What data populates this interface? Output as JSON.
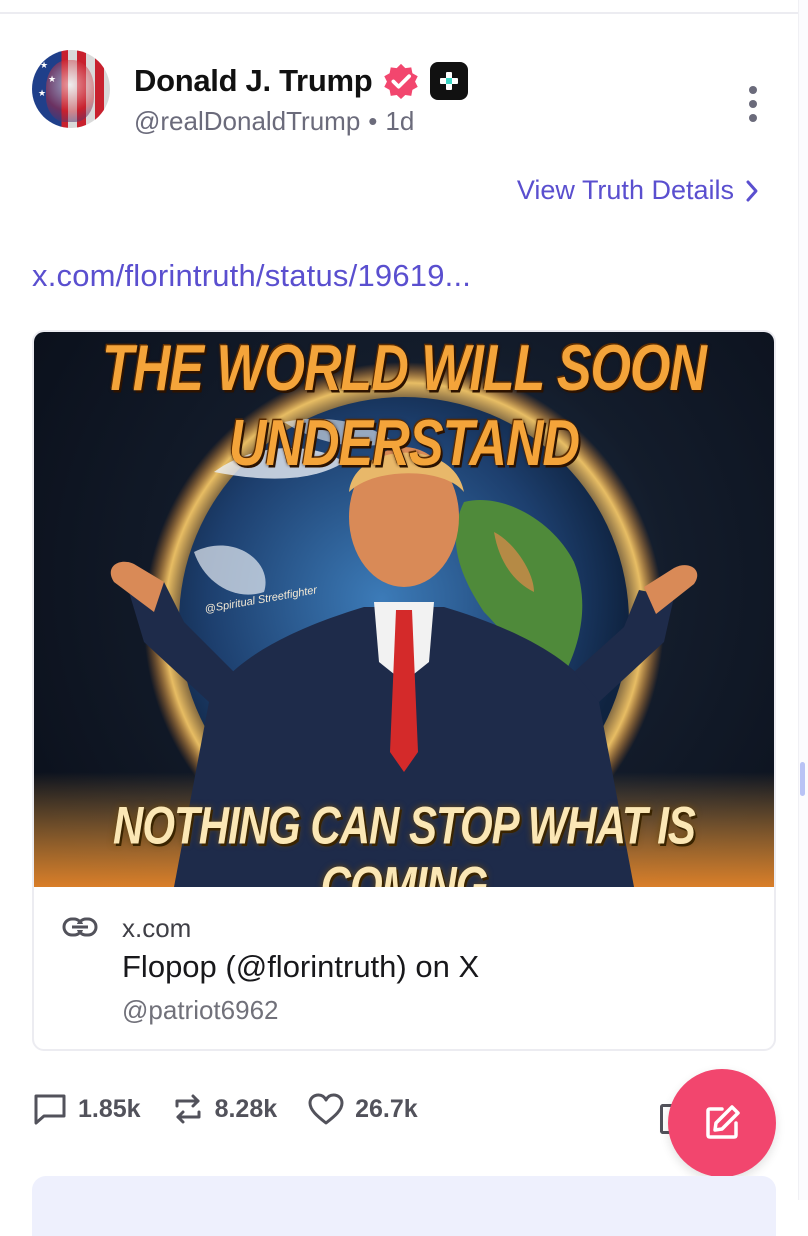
{
  "post": {
    "author": {
      "display_name": "Donald J. Trump",
      "handle": "@realDonaldTrump",
      "separator": "•",
      "time_ago": "1d"
    },
    "verified_icon": "verified-check-badge",
    "plus_icon": "truth-plus-badge",
    "view_details_label": "View Truth Details",
    "link_text": "x.com/florintruth/status/19619...",
    "card": {
      "image_top_text": "THE WORLD WILL SOON UNDERSTAND",
      "image_bottom_text": "NOTHING CAN STOP WHAT IS COMING",
      "image_watermark": "@Spiritual Streetfighter",
      "domain": "x.com",
      "title": "Flopop (@florintruth) on X",
      "author": "@patriot6962"
    },
    "actions": {
      "replies": "1.85k",
      "retruths": "8.28k",
      "likes": "26.7k"
    }
  },
  "colors": {
    "accent": "#5a4fcf",
    "fab": "#f2466e",
    "verified": "#f2466e"
  }
}
